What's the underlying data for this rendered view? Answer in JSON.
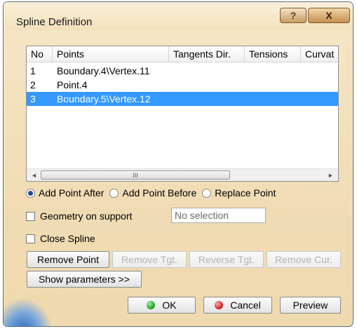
{
  "window": {
    "title": "Spline Definition"
  },
  "titlebar": {
    "help_label": "?",
    "close_label": "X"
  },
  "table": {
    "columns": [
      "No",
      "Points",
      "Tangents Dir.",
      "Tensions",
      "Curvat"
    ],
    "rows": [
      {
        "no": "1",
        "point": "Boundary.4\\Vertex.11",
        "selected": false
      },
      {
        "no": "2",
        "point": "Point.4",
        "selected": false
      },
      {
        "no": "3",
        "point": "Boundary.5\\Vertex.12",
        "selected": true
      }
    ],
    "scroll_grip": "III"
  },
  "mode": {
    "options": [
      "Add Point After",
      "Add Point Before",
      "Replace Point"
    ],
    "selected": "Add Point After"
  },
  "geometry_support": {
    "label": "Geometry on support",
    "checked": false,
    "value": "No selection"
  },
  "close_spline": {
    "label": "Close Spline",
    "checked": false
  },
  "actions": {
    "remove_point": "Remove Point",
    "remove_tgt": "Remove Tgt.",
    "reverse_tgt": "Reverse Tgt.",
    "remove_cur": "Remove Cur.",
    "show_parameters": "Show parameters >>"
  },
  "footer": {
    "ok": "OK",
    "cancel": "Cancel",
    "preview": "Preview"
  }
}
